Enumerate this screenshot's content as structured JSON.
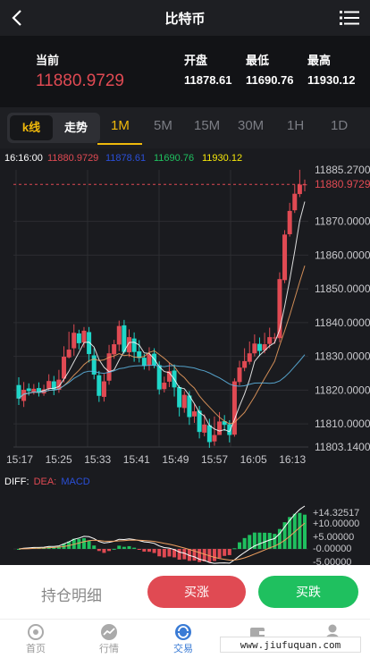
{
  "header": {
    "title": "比特币"
  },
  "quote": {
    "current_label": "当前",
    "current_value": "11880.9729",
    "open_label": "开盘",
    "open_value": "11878.61",
    "low_label": "最低",
    "low_value": "11690.76",
    "high_label": "最高",
    "high_value": "11930.12"
  },
  "tabs": {
    "kline": "k线",
    "trend": "走势",
    "timeframes": [
      "1M",
      "5M",
      "15M",
      "30M",
      "1H",
      "1D"
    ],
    "active_timeframe": "1M"
  },
  "info_bar": {
    "time": "16:16:00",
    "value1": "11880.9729",
    "value2": "11878.61",
    "value3": "11690.76",
    "value4": "11930.12"
  },
  "macd_legend": {
    "diff": "DIFF:",
    "dea": "DEA:",
    "macd": "MACD"
  },
  "colors": {
    "up": "#e04a53",
    "down": "#1fd6c8",
    "accent": "#f0b90b",
    "green": "#1fc05f",
    "blue": "#3a7bd5"
  },
  "chart_data": {
    "type": "candlestick",
    "x_tick_labels": [
      "15:17",
      "15:25",
      "15:33",
      "15:41",
      "15:49",
      "15:57",
      "16:05",
      "16:13"
    ],
    "y_tick_labels": [
      "11885.2700",
      "11880.9729",
      "11870.0000",
      "11860.0000",
      "11850.0000",
      "11840.0000",
      "11830.0000",
      "11820.0000",
      "11810.0000",
      "11803.1400"
    ],
    "y_range": [
      11803.14,
      11885.27
    ],
    "last_price": 11880.9729,
    "candles": [
      [
        11821.5,
        11817.5,
        11823.8,
        11815.6
      ],
      [
        11816.8,
        11820.1,
        11822.4,
        11815.0
      ],
      [
        11820.5,
        11819.7,
        11822.0,
        11818.4
      ],
      [
        11819.4,
        11820.4,
        11821.8,
        11818.7
      ],
      [
        11820.6,
        11819.2,
        11822.3,
        11818.1
      ],
      [
        11819.0,
        11820.2,
        11821.6,
        11818.3
      ],
      [
        11820.4,
        11822.7,
        11824.7,
        11819.7
      ],
      [
        11822.6,
        11820.2,
        11824.2,
        11818.5
      ],
      [
        11820.1,
        11823.1,
        11826.0,
        11819.2
      ],
      [
        11823.4,
        11829.9,
        11833.0,
        11822.3
      ],
      [
        11829.7,
        11832.0,
        11837.3,
        11829.4
      ],
      [
        11832.4,
        11837.0,
        11839.5,
        11830.2
      ],
      [
        11836.8,
        11833.9,
        11837.9,
        11832.1
      ],
      [
        11834.1,
        11837.6,
        11838.7,
        11832.6
      ],
      [
        11837.2,
        11830.7,
        11838.7,
        11828.2
      ],
      [
        11830.3,
        11824.6,
        11832.4,
        11823.2
      ],
      [
        11824.4,
        11818.3,
        11825.7,
        11816.5
      ],
      [
        11818.0,
        11822.6,
        11824.8,
        11816.6
      ],
      [
        11822.8,
        11830.9,
        11833.4,
        11821.6
      ],
      [
        11830.6,
        11833.6,
        11834.9,
        11829.3
      ],
      [
        11833.5,
        11839.0,
        11840.6,
        11831.6
      ],
      [
        11839.2,
        11831.3,
        11840.8,
        11830.8
      ],
      [
        11831.2,
        11835.7,
        11838.0,
        11829.8
      ],
      [
        11835.3,
        11831.3,
        11837.1,
        11828.4
      ],
      [
        11831.5,
        11829.5,
        11834.8,
        11828.2
      ],
      [
        11829.6,
        11827.2,
        11830.7,
        11826.1
      ],
      [
        11827.4,
        11830.6,
        11832.7,
        11825.8
      ],
      [
        11830.8,
        11827.3,
        11832.4,
        11826.5
      ],
      [
        11827.4,
        11820.2,
        11828.5,
        11818.7
      ],
      [
        11820.3,
        11822.2,
        11824.0,
        11819.3
      ],
      [
        11822.5,
        11825.6,
        11828.1,
        11820.9
      ],
      [
        11825.8,
        11820.8,
        11827.6,
        11818.1
      ],
      [
        11820.9,
        11814.9,
        11821.4,
        11812.2
      ],
      [
        11814.7,
        11818.6,
        11819.7,
        11813.3
      ],
      [
        11818.4,
        11812.0,
        11819.7,
        11809.7
      ],
      [
        11812.2,
        11813.7,
        11815.8,
        11810.3
      ],
      [
        11813.9,
        11807.6,
        11815.3,
        11805.7
      ],
      [
        11807.4,
        11809.8,
        11812.8,
        11806.3
      ],
      [
        11809.6,
        11804.6,
        11811.5,
        11802.9
      ],
      [
        11804.8,
        11806.7,
        11812.2,
        11803.5
      ],
      [
        11806.7,
        11810.7,
        11813.5,
        11806.8
      ],
      [
        11810.8,
        11809.7,
        11812.6,
        11807.9
      ],
      [
        11809.9,
        11806.7,
        11811.1,
        11804.5
      ],
      [
        11806.8,
        11822.6,
        11823.5,
        11806.2
      ],
      [
        11822.4,
        11826.7,
        11828.7,
        11821.4
      ],
      [
        11826.6,
        11828.6,
        11832.4,
        11825.6
      ],
      [
        11828.4,
        11830.9,
        11834.4,
        11827.6
      ],
      [
        11830.9,
        11833.8,
        11836.5,
        11830.0
      ],
      [
        11833.7,
        11831.6,
        11835.6,
        11830.2
      ],
      [
        11831.8,
        11833.6,
        11837.0,
        11830.9
      ],
      [
        11833.7,
        11835.7,
        11838.5,
        11832.4
      ],
      [
        11835.5,
        11835.6,
        11836.9,
        11833.7
      ],
      [
        11835.4,
        11852.9,
        11854.9,
        11834.2
      ],
      [
        11852.6,
        11866.1,
        11867.4,
        11851.7
      ],
      [
        11866.2,
        11873.1,
        11875.5,
        11865.5
      ],
      [
        11873.3,
        11878.2,
        11880.9,
        11872.5
      ],
      [
        11878.1,
        11880.9,
        11885.3,
        11877.2
      ],
      [
        11880.9,
        11880.9729,
        11882.4,
        11878.9
      ]
    ]
  }
}
